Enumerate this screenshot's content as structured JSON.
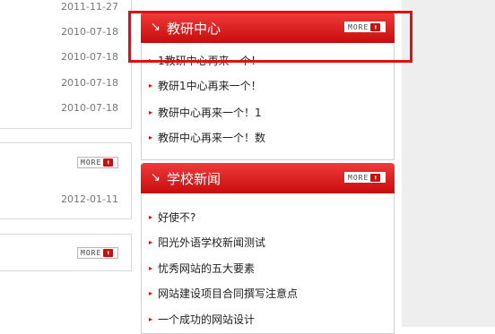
{
  "left": {
    "dates": [
      "2011-11-27",
      "2010-07-18",
      "2010-07-18",
      "2010-07-18",
      "2010-07-18"
    ],
    "box1": {
      "more_label": "MORE",
      "date": "2012-01-11"
    },
    "box2": {
      "more_label": "MORE"
    }
  },
  "panels": [
    {
      "title": "教研中心",
      "more_label": "MORE",
      "items": [
        "1教研中心再来一个！",
        "教研1中心再来一个！",
        "教研中心再来一个！1",
        "教研中心再来一个！数"
      ]
    },
    {
      "title": "学校新闻",
      "more_label": "MORE",
      "items": [
        "好使不?",
        "阳光外语学校新闻测试",
        "忧秀网站的五大要素",
        "网站建设项目合同撰写注意点",
        "一个成功的网站设计"
      ]
    }
  ],
  "colors": {
    "accent": "#d40b0b",
    "highlight_border": "#e01010"
  },
  "icons": {
    "panel_title": "chevron-down-right-icon",
    "more": "arrow-up-icon"
  }
}
